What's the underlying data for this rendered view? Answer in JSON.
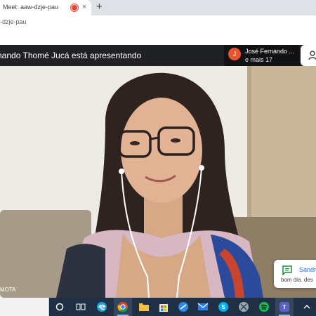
{
  "browser": {
    "tab_title": "Meet: aaw-dzje-pau",
    "tab_close": "×",
    "new_tab": "+",
    "address": "-dzje-pau"
  },
  "meet": {
    "presenting_text": "nando Thomé Jucá está apresentando",
    "participant_initial": "J",
    "participant_name": "José Fernando ...",
    "participant_more": "e mais 17",
    "tile_name": "MOTA"
  },
  "chat_toast": {
    "sender": "Sandr",
    "message": "bom dia. des"
  },
  "taskbar": {
    "items": [
      "cortana-icon",
      "task-view-icon",
      "edge-icon",
      "chrome-icon",
      "file-explorer-icon",
      "store-icon",
      "browser-icon",
      "mail-icon",
      "skype-icon",
      "snipping-tool-icon",
      "spotify-icon",
      "teams-icon",
      "tray-chevron-icon"
    ]
  },
  "colors": {
    "recording": "#ea4335",
    "avatar": "#e8552c",
    "chat_accent": "#1a73e8",
    "meet_bg": "#202124",
    "taskbar": "#1f3045"
  }
}
